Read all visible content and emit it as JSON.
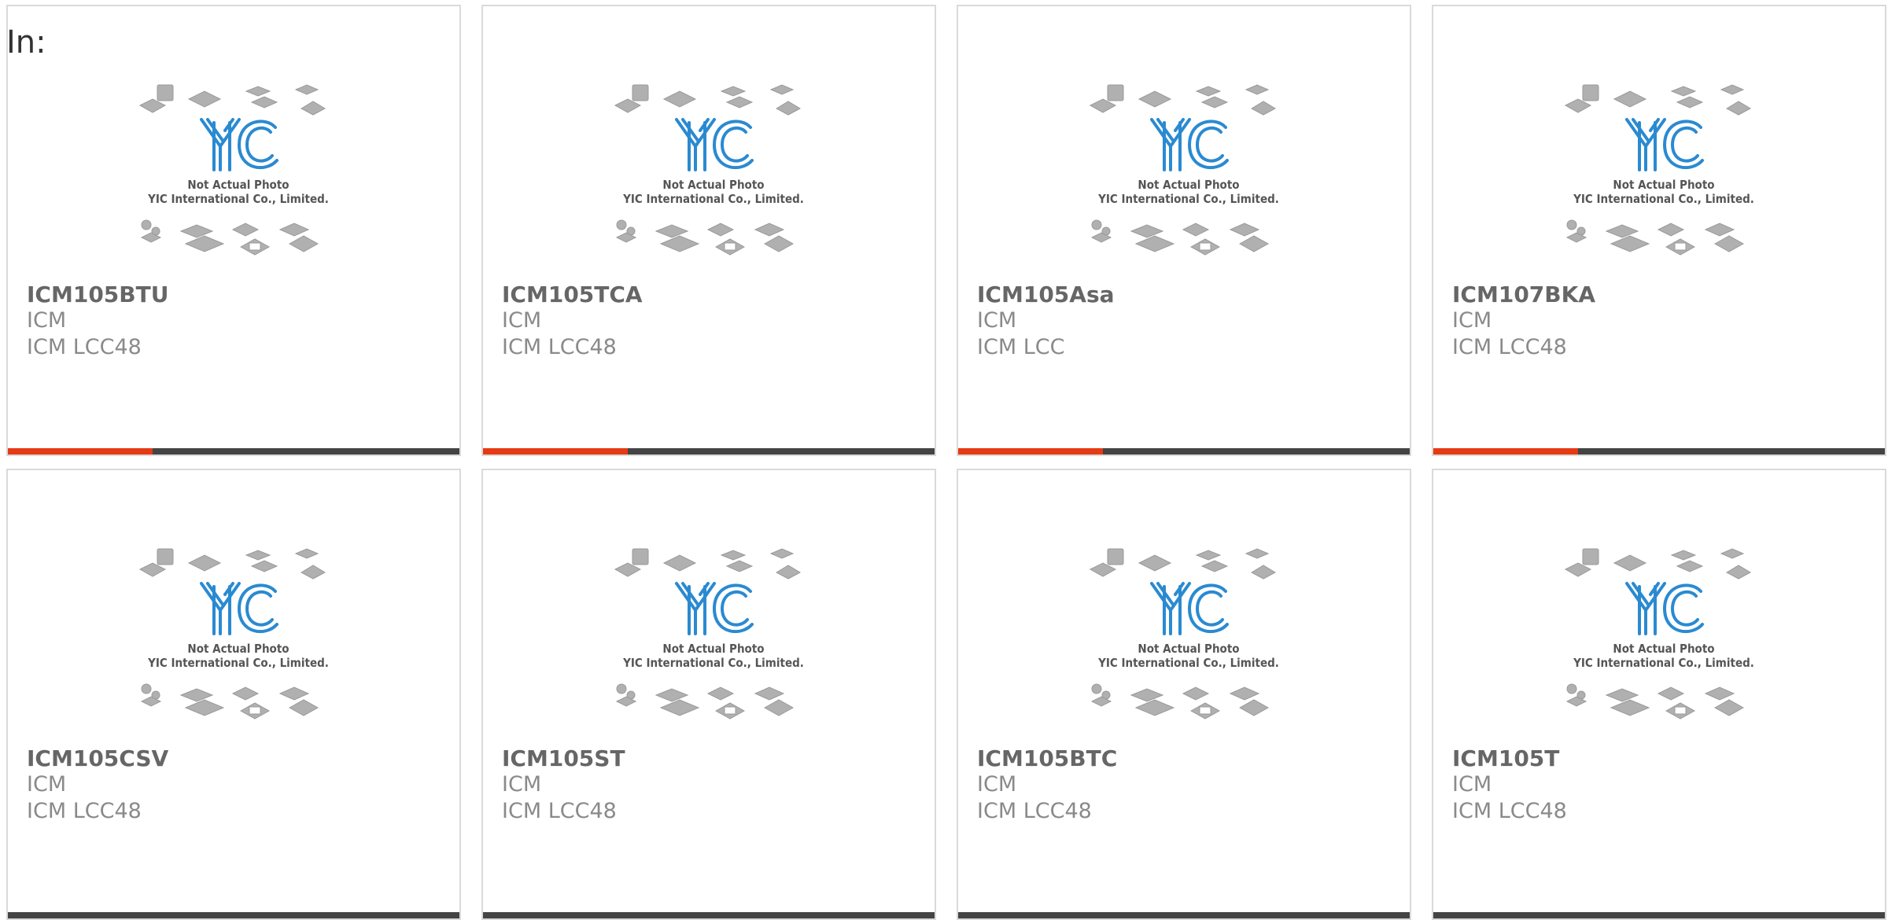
{
  "header": {
    "label": "In:"
  },
  "photo": {
    "caption_line1": "Not Actual Photo",
    "caption_line2": "YIC International Co., Limited.",
    "logo_text": "YIC"
  },
  "colors": {
    "accent": "#e63a14",
    "bar": "#444444",
    "logo_blue": "#2a8ad1",
    "chip_gray": "#aaaaaa"
  },
  "products": [
    {
      "part": "ICM105BTU",
      "brand": "ICM",
      "package": "ICM LCC48",
      "progress": 0.32
    },
    {
      "part": "ICM105TCA",
      "brand": "ICM",
      "package": "ICM LCC48",
      "progress": 0.32
    },
    {
      "part": "ICM105Asa",
      "brand": "ICM",
      "package": "ICM LCC",
      "progress": 0.32
    },
    {
      "part": "ICM107BKA",
      "brand": "ICM",
      "package": "ICM LCC48",
      "progress": 0.32
    },
    {
      "part": "ICM105CSV",
      "brand": "ICM",
      "package": "ICM LCC48",
      "progress": 0
    },
    {
      "part": "ICM105ST",
      "brand": "ICM",
      "package": "ICM LCC48",
      "progress": 0
    },
    {
      "part": "ICM105BTC",
      "brand": "ICM",
      "package": "ICM LCC48",
      "progress": 0
    },
    {
      "part": "ICM105T",
      "brand": "ICM",
      "package": "ICM LCC48",
      "progress": 0
    }
  ]
}
